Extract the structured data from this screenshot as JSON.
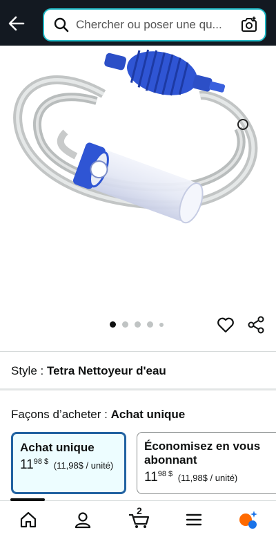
{
  "header": {
    "search_placeholder": "Chercher ou poser une qu...",
    "back_icon": "back-arrow-icon",
    "search_icon": "search-icon",
    "camera_icon": "camera-search-icon",
    "colors": {
      "background": "#131921",
      "search_border": "#1fb8c5"
    }
  },
  "gallery": {
    "image_alt": "Siphon d'aquarium avec tuyau transparent et poire bleue",
    "dot_count": 5,
    "active_dot": 1
  },
  "style": {
    "label": "Style :",
    "value": "Tetra Nettoyeur d'eau"
  },
  "purchase": {
    "label": "Façons d’acheter :",
    "value": "Achat unique",
    "options": [
      {
        "title": "Achat unique",
        "price_whole": "11",
        "price_fraction": "98 $",
        "unit_price": "(11,98$ / unité)",
        "selected": true
      },
      {
        "title": "Économisez en vous abonnant",
        "price_whole": "11",
        "price_fraction": "98 $",
        "unit_price": "(11,98$ / unité)",
        "selected": false
      }
    ]
  },
  "nav": {
    "cart_count": "2",
    "items": [
      "home-icon",
      "account-icon",
      "cart-icon",
      "menu-icon",
      "rufus-assistant-icon"
    ]
  }
}
